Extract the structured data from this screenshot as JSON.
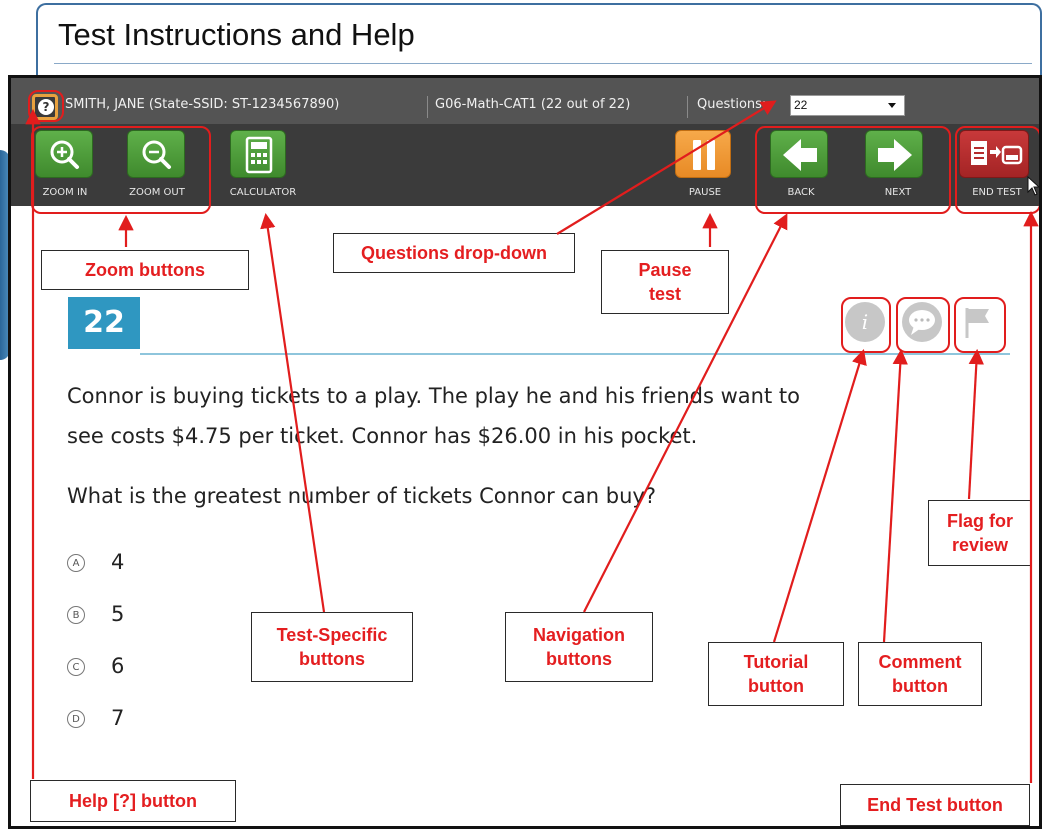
{
  "header": {
    "title": "Test Instructions and Help"
  },
  "top_bar": {
    "help_glyph": "?",
    "student": "SMITH, JANE (State-SSID: ST-1234567890)",
    "test_name": "G06-Math-CAT1 (22 out of 22)",
    "questions_label": "Questions:",
    "questions_value": "22"
  },
  "toolbar": {
    "zoom_in": "ZOOM IN",
    "zoom_out": "ZOOM OUT",
    "calculator": "CALCULATOR",
    "pause": "PAUSE",
    "back": "BACK",
    "next": "NEXT",
    "end_test": "END TEST"
  },
  "callouts": {
    "zoom": "Zoom buttons",
    "questions_dropdown": "Questions drop-down",
    "pause_line1": "Pause",
    "pause_line2": "test",
    "test_specific_line1": "Test-Specific",
    "test_specific_line2": "buttons",
    "navigation_line1": "Navigation",
    "navigation_line2": "buttons",
    "tutorial_line1": "Tutorial",
    "tutorial_line2": "button",
    "comment_line1": "Comment",
    "comment_line2": "button",
    "flag_line1": "Flag for",
    "flag_line2": "review",
    "help": "Help [?] button",
    "end_test": "End Test button"
  },
  "question": {
    "number": "22",
    "stem_line1": "Connor is buying tickets to a play. The play he and his friends want to",
    "stem_line2": "see costs $4.75 per ticket. Connor has $26.00 in his pocket.",
    "prompt": "What is the greatest number of tickets Connor can buy?",
    "options": [
      {
        "letter": "A",
        "text": "4"
      },
      {
        "letter": "B",
        "text": "5"
      },
      {
        "letter": "C",
        "text": "6"
      },
      {
        "letter": "D",
        "text": "7"
      }
    ]
  },
  "colors": {
    "annotation_red": "#e11d1d",
    "question_number_blue": "#2f97c1",
    "toolbar_green": "#4f9e3c",
    "pause_orange": "#f09a33",
    "end_test_red": "#b52b2c"
  }
}
